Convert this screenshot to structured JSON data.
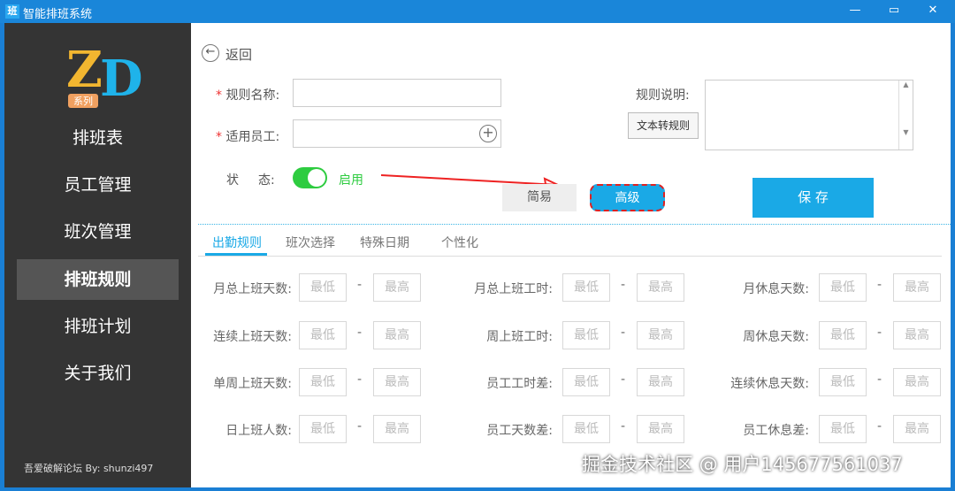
{
  "window": {
    "title": "智能排班系统",
    "icon": "班",
    "minimize": "—",
    "maximize": "▭",
    "close": "✕"
  },
  "sidebar": {
    "logo": "ZD",
    "logo_sub": "系列",
    "items": [
      "排班表",
      "员工管理",
      "班次管理",
      "排班规则",
      "排班计划",
      "关于我们"
    ],
    "active": 3,
    "credit": "吾爱破解论坛 By: shunzi497"
  },
  "form": {
    "back": "返回",
    "rule_name_label": "规则名称:",
    "employees_label": "适用员工:",
    "desc_label": "规则说明:",
    "convert_btn": "文本转规则",
    "status_label": "状",
    "status_label2": "态:",
    "status_value": "启用",
    "simple": "简易",
    "advanced": "高级",
    "save": "保 存"
  },
  "tabs": [
    "出勤规则",
    "班次选择",
    "特殊日期",
    "个性化"
  ],
  "rules": {
    "min": "最低",
    "max": "最高",
    "dash": "-",
    "rows": [
      [
        "月总上班天数:",
        "月总上班工时:",
        "月休息天数:"
      ],
      [
        "连续上班天数:",
        "周上班工时:",
        "周休息天数:"
      ],
      [
        "单周上班天数:",
        "员工工时差:",
        "连续休息天数:"
      ],
      [
        "日上班人数:",
        "员工天数差:",
        "员工休息差:"
      ]
    ]
  },
  "watermark": "掘金技术社区 @ 用户145677561037"
}
